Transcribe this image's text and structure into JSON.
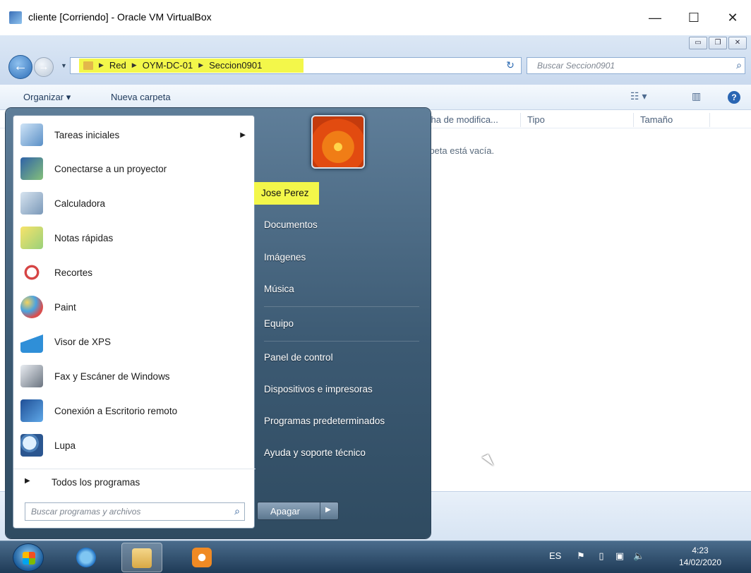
{
  "vbox": {
    "title": "cliente [Corriendo] - Oracle VM VirtualBox",
    "controls": {
      "minimize": "—",
      "maximize": "☐",
      "close": "✕"
    }
  },
  "explorer": {
    "breadcrumb": [
      "Red",
      "OYM-DC-01",
      "Seccion0901"
    ],
    "search_placeholder": "Buscar Seccion0901",
    "toolbar": {
      "organize": "Organizar ▾",
      "new_folder": "Nueva carpeta"
    },
    "columns": {
      "date": "cha de modifica...",
      "type": "Tipo",
      "size": "Tamaño"
    },
    "empty_message": "rpeta está vacía."
  },
  "start_menu": {
    "programs": [
      {
        "label": "Tareas iniciales",
        "icon": "getting-started-icon",
        "has_submenu": true
      },
      {
        "label": "Conectarse a un proyector",
        "icon": "projector-icon"
      },
      {
        "label": "Calculadora",
        "icon": "calculator-icon"
      },
      {
        "label": "Notas rápidas",
        "icon": "sticky-notes-icon"
      },
      {
        "label": "Recortes",
        "icon": "snipping-tool-icon"
      },
      {
        "label": "Paint",
        "icon": "paint-icon"
      },
      {
        "label": "Visor de XPS",
        "icon": "xps-viewer-icon"
      },
      {
        "label": "Fax y Escáner de Windows",
        "icon": "fax-scanner-icon"
      },
      {
        "label": "Conexión a Escritorio remoto",
        "icon": "remote-desktop-icon"
      },
      {
        "label": "Lupa",
        "icon": "magnifier-icon"
      }
    ],
    "all_programs": "Todos los programas",
    "search_placeholder": "Buscar programas y archivos",
    "user_name": "Jose Perez",
    "right_items": [
      "Documentos",
      "Imágenes",
      "Música",
      "Equipo",
      "Panel de control",
      "Dispositivos e impresoras",
      "Programas predeterminados",
      "Ayuda y soporte técnico"
    ],
    "shutdown_label": "Apagar"
  },
  "taskbar": {
    "language": "ES",
    "time": "4:23",
    "date": "14/02/2020"
  }
}
